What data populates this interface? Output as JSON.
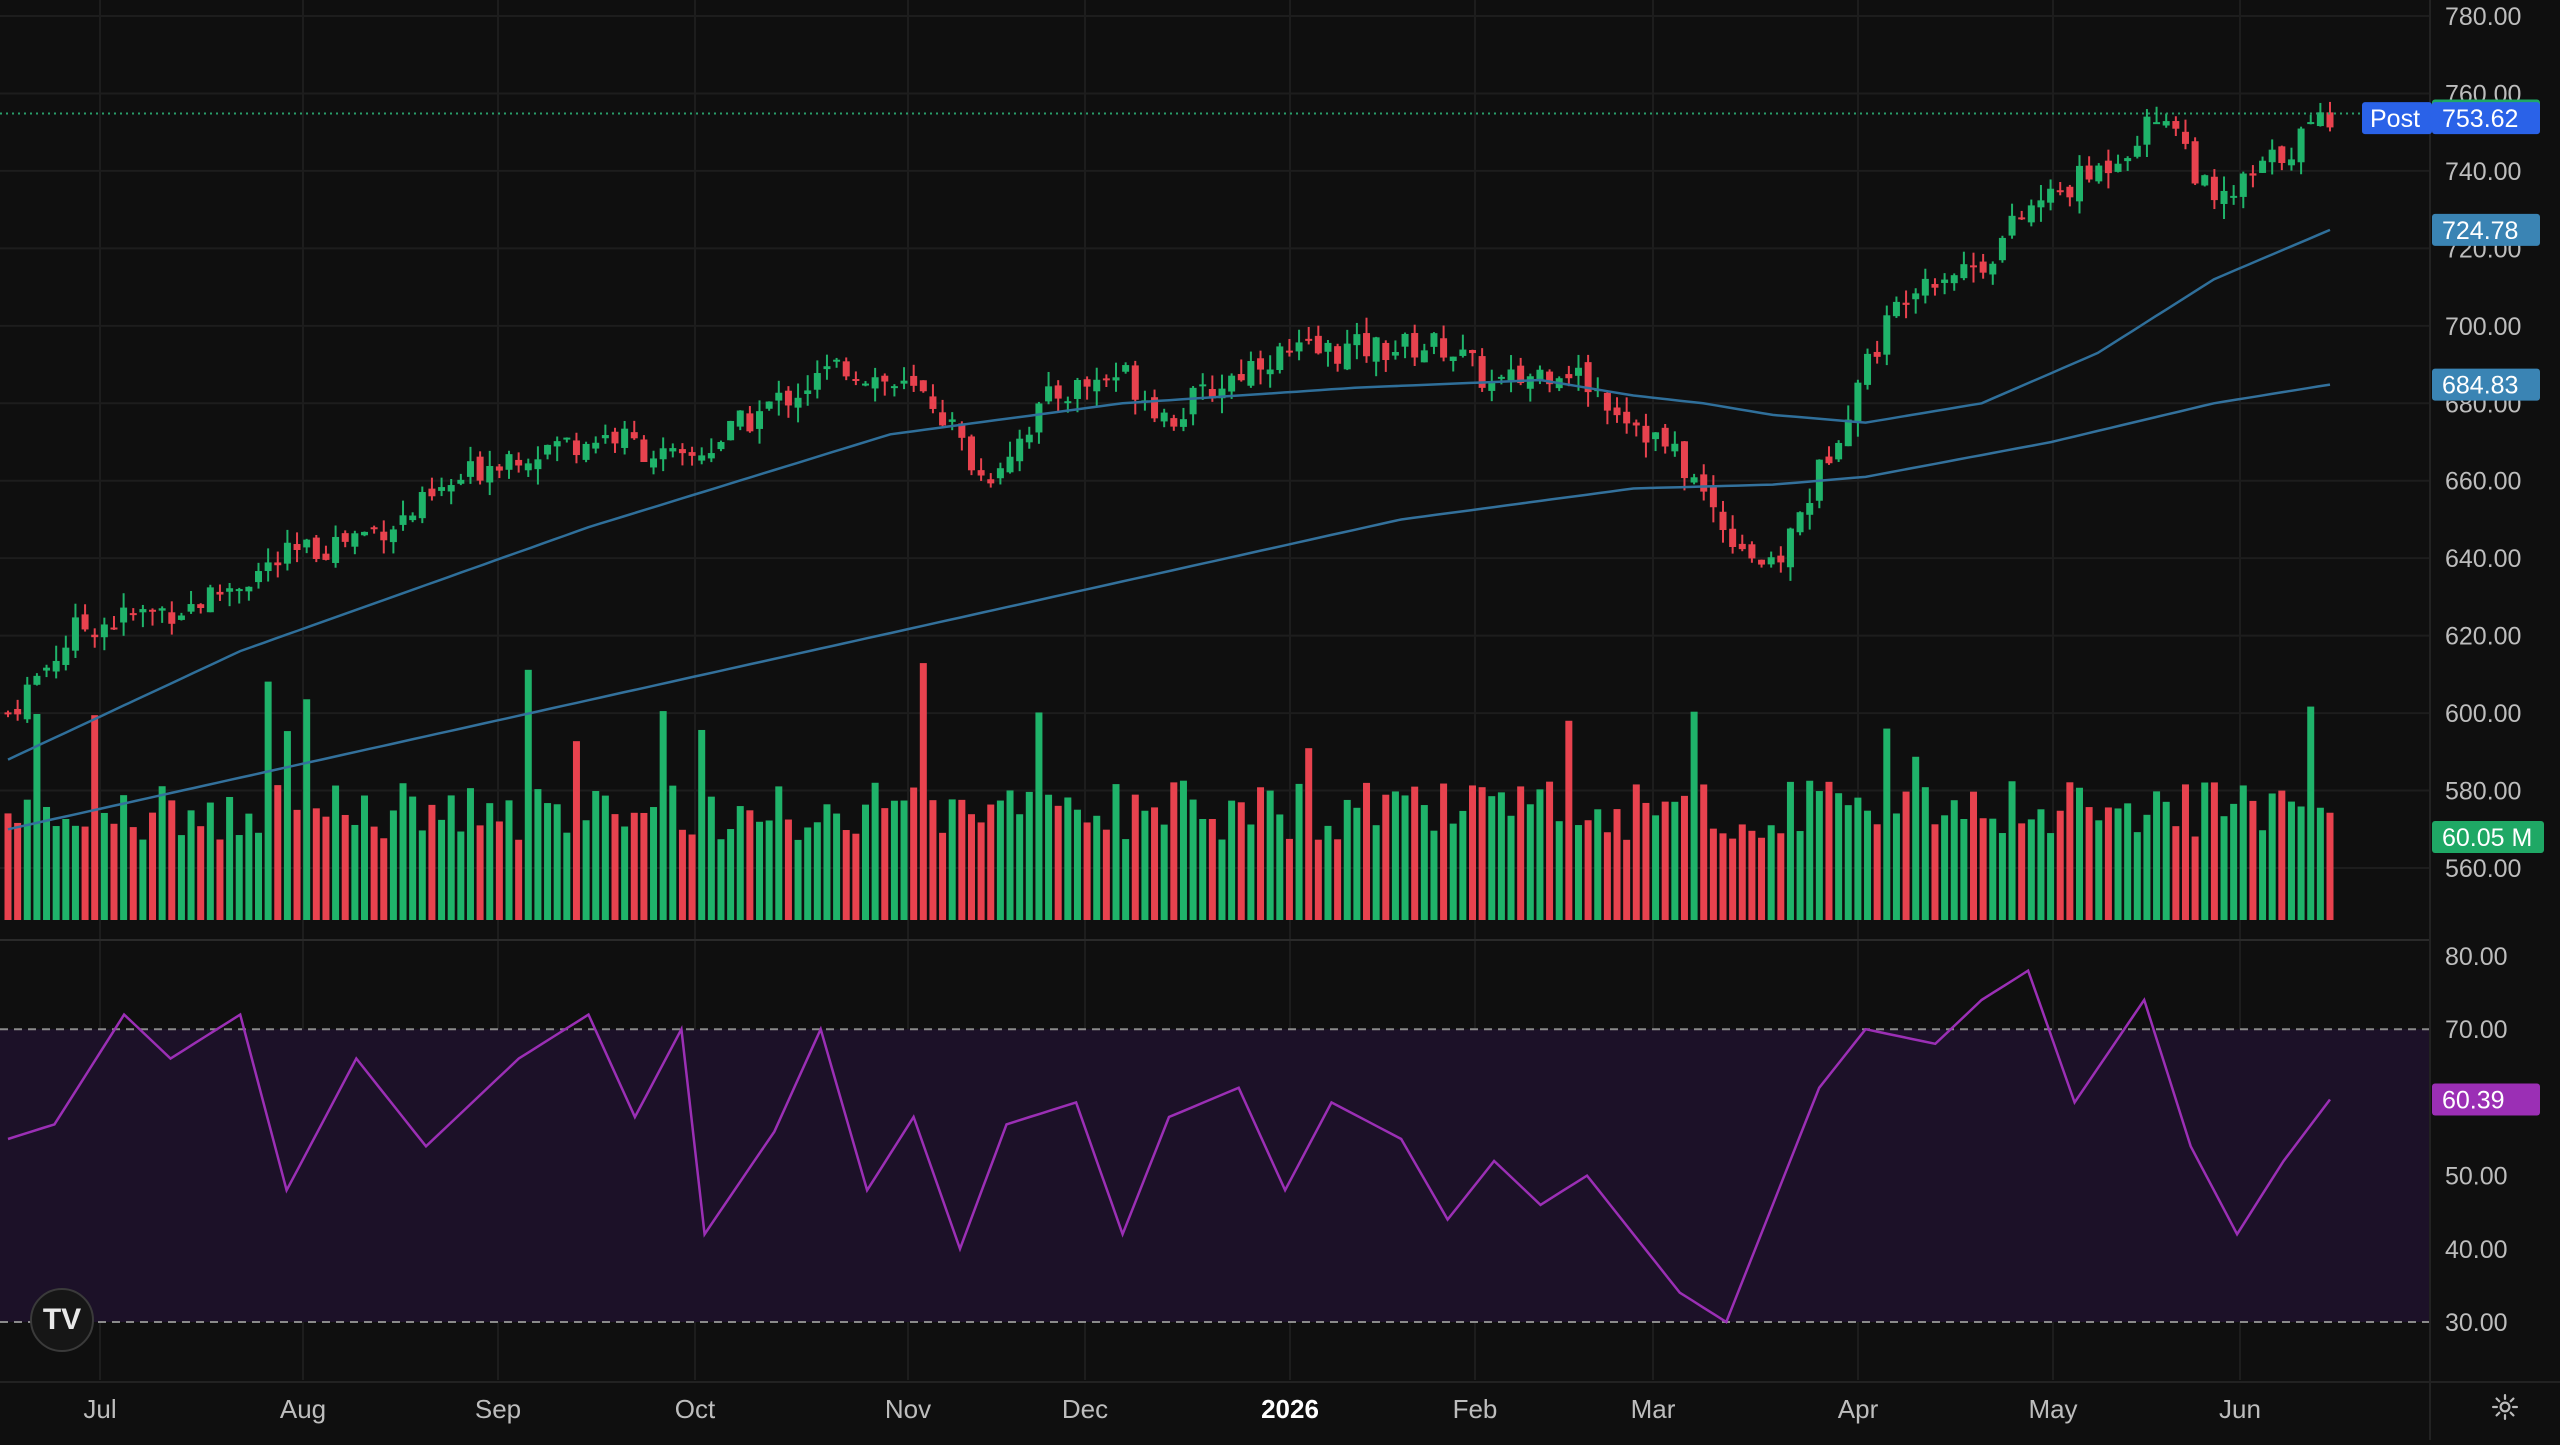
{
  "chart_data": {
    "type": "candlestick",
    "symbol_context": "daily price with 50/200 moving averages, volume and RSI",
    "price_axis": {
      "ticks": [
        "780.00",
        "760.00",
        "740.00",
        "720.00",
        "700.00",
        "680.00",
        "660.00",
        "640.00",
        "620.00",
        "600.00",
        "580.00",
        "560.00"
      ],
      "ylim": [
        552,
        784
      ]
    },
    "time_axis": {
      "labels": [
        "Jul",
        "Aug",
        "Sep",
        "Oct",
        "Nov",
        "Dec",
        "2026",
        "Feb",
        "Mar",
        "Apr",
        "May",
        "Jun"
      ],
      "year_label": "2026"
    },
    "price_labels": {
      "last": "754.83",
      "post_tag": "Post",
      "post": "753.62",
      "ma50": "724.78",
      "ma200": "684.83",
      "volume": "60.05 M"
    },
    "closes_monthly_anchors": [
      {
        "t": 0,
        "close": 600
      },
      {
        "t": 0.03,
        "close": 622
      },
      {
        "t": 0.08,
        "close": 628
      },
      {
        "t": 0.12,
        "close": 640
      },
      {
        "t": 0.17,
        "close": 650
      },
      {
        "t": 0.21,
        "close": 666
      },
      {
        "t": 0.26,
        "close": 672
      },
      {
        "t": 0.29,
        "close": 664
      },
      {
        "t": 0.33,
        "close": 680
      },
      {
        "t": 0.36,
        "close": 690
      },
      {
        "t": 0.4,
        "close": 680
      },
      {
        "t": 0.42,
        "close": 660
      },
      {
        "t": 0.45,
        "close": 682
      },
      {
        "t": 0.48,
        "close": 688
      },
      {
        "t": 0.5,
        "close": 676
      },
      {
        "t": 0.54,
        "close": 692
      },
      {
        "t": 0.58,
        "close": 694
      },
      {
        "t": 0.62,
        "close": 695
      },
      {
        "t": 0.64,
        "close": 684
      },
      {
        "t": 0.67,
        "close": 690
      },
      {
        "t": 0.7,
        "close": 676
      },
      {
        "t": 0.72,
        "close": 665
      },
      {
        "t": 0.74,
        "close": 648
      },
      {
        "t": 0.76,
        "close": 636
      },
      {
        "t": 0.78,
        "close": 662
      },
      {
        "t": 0.8,
        "close": 690
      },
      {
        "t": 0.82,
        "close": 712
      },
      {
        "t": 0.85,
        "close": 716
      },
      {
        "t": 0.87,
        "close": 730
      },
      {
        "t": 0.9,
        "close": 740
      },
      {
        "t": 0.93,
        "close": 756
      },
      {
        "t": 0.95,
        "close": 730
      },
      {
        "t": 0.97,
        "close": 740
      },
      {
        "t": 1.0,
        "close": 754.83
      }
    ],
    "ma50_anchors": [
      [
        0,
        588
      ],
      [
        0.1,
        616
      ],
      [
        0.25,
        648
      ],
      [
        0.38,
        672
      ],
      [
        0.48,
        680
      ],
      [
        0.58,
        684
      ],
      [
        0.66,
        686
      ],
      [
        0.7,
        682
      ],
      [
        0.73,
        680
      ],
      [
        0.76,
        677
      ],
      [
        0.8,
        675
      ],
      [
        0.85,
        680
      ],
      [
        0.9,
        693
      ],
      [
        0.95,
        712
      ],
      [
        1.0,
        724.78
      ]
    ],
    "ma200_anchors": [
      [
        0,
        570
      ],
      [
        0.15,
        590
      ],
      [
        0.3,
        610
      ],
      [
        0.45,
        630
      ],
      [
        0.6,
        650
      ],
      [
        0.7,
        658
      ],
      [
        0.76,
        659
      ],
      [
        0.8,
        661
      ],
      [
        0.88,
        670
      ],
      [
        0.95,
        680
      ],
      [
        1.0,
        684.83
      ]
    ],
    "rsi": {
      "ticks": [
        "80.00",
        "70.00",
        "60.00",
        "50.00",
        "40.00",
        "30.00"
      ],
      "levels": [
        70,
        30
      ],
      "last": "60.39",
      "anchors": [
        [
          0,
          55
        ],
        [
          0.02,
          57
        ],
        [
          0.05,
          72
        ],
        [
          0.07,
          66
        ],
        [
          0.1,
          72
        ],
        [
          0.12,
          48
        ],
        [
          0.15,
          66
        ],
        [
          0.18,
          54
        ],
        [
          0.22,
          66
        ],
        [
          0.25,
          72
        ],
        [
          0.27,
          58
        ],
        [
          0.29,
          70
        ],
        [
          0.3,
          42
        ],
        [
          0.33,
          56
        ],
        [
          0.35,
          70
        ],
        [
          0.37,
          48
        ],
        [
          0.39,
          58
        ],
        [
          0.41,
          40
        ],
        [
          0.43,
          57
        ],
        [
          0.46,
          60
        ],
        [
          0.48,
          42
        ],
        [
          0.5,
          58
        ],
        [
          0.53,
          62
        ],
        [
          0.55,
          48
        ],
        [
          0.57,
          60
        ],
        [
          0.6,
          55
        ],
        [
          0.62,
          44
        ],
        [
          0.64,
          52
        ],
        [
          0.66,
          46
        ],
        [
          0.68,
          50
        ],
        [
          0.7,
          42
        ],
        [
          0.72,
          34
        ],
        [
          0.74,
          30
        ],
        [
          0.76,
          46
        ],
        [
          0.78,
          62
        ],
        [
          0.8,
          70
        ],
        [
          0.83,
          68
        ],
        [
          0.85,
          74
        ],
        [
          0.87,
          78
        ],
        [
          0.89,
          60
        ],
        [
          0.92,
          74
        ],
        [
          0.94,
          54
        ],
        [
          0.96,
          42
        ],
        [
          0.98,
          52
        ],
        [
          1.0,
          60.39
        ]
      ]
    }
  },
  "colors": {
    "up": "#1fb36a",
    "down": "#e8424e",
    "ma50": "#2f6f9a",
    "ma200": "#33719c",
    "rsi_line": "#9b2fb5",
    "rsi_band": "#1c1128",
    "last_tag": "#1fa865",
    "post_tag": "#2a62e8",
    "ma_tag": "#3a84b4",
    "rsi_tag": "#9b2fb5"
  },
  "ui": {
    "logo_text": "TV",
    "settings_icon": "gear-icon"
  }
}
